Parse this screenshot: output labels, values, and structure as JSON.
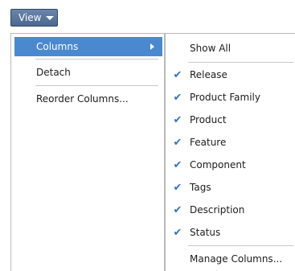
{
  "view_button": {
    "label": "View"
  },
  "main_menu": {
    "items": [
      {
        "label": "Columns",
        "active": true,
        "has_submenu": true
      },
      {
        "label": "Detach"
      },
      {
        "label": "Reorder Columns..."
      }
    ]
  },
  "columns_submenu": {
    "show_all": "Show All",
    "items": [
      {
        "label": "Release",
        "checked": true
      },
      {
        "label": "Product Family",
        "checked": true
      },
      {
        "label": "Product",
        "checked": true
      },
      {
        "label": "Feature",
        "checked": true
      },
      {
        "label": "Component",
        "checked": true
      },
      {
        "label": "Tags",
        "checked": true
      },
      {
        "label": "Description",
        "checked": true
      },
      {
        "label": "Status",
        "checked": true
      }
    ],
    "manage": "Manage Columns..."
  },
  "icons": {
    "check": "✔"
  },
  "colors": {
    "accent": "#4a89d0",
    "check": "#2f73c8",
    "view_button": "#5a769c"
  }
}
